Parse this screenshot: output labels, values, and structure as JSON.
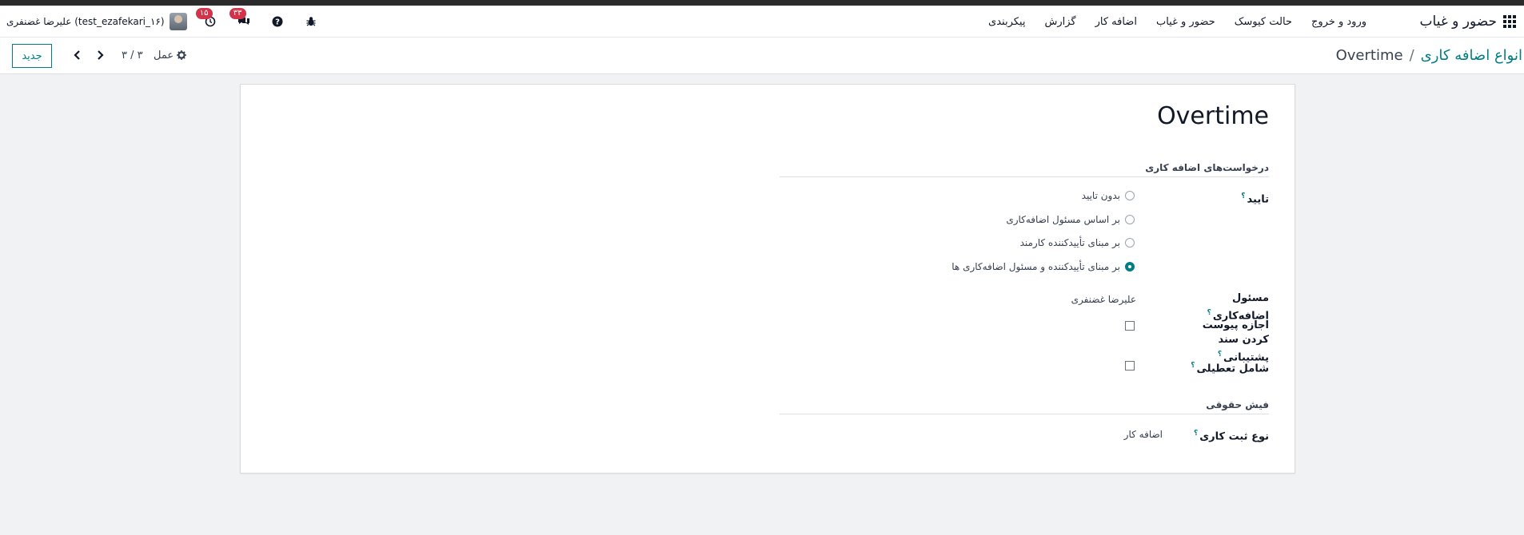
{
  "nav": {
    "brand": "حضور و غیاب",
    "menu": [
      "ورود و خروج",
      "حالت کیوسک",
      "حضور و غیاب",
      "اضافه کار",
      "گزارش",
      "پیکربندی"
    ],
    "user": "علیرضا غضنفری (test_ezafekari_۱۶)",
    "activity_badge": "۱۵",
    "messages_badge": "۳۳"
  },
  "control": {
    "breadcrumb_parent": "انواع اضافه کاری",
    "breadcrumb_sep": "/",
    "breadcrumb_current": "Overtime",
    "new_button": "جدید",
    "pager": "۳ / ۳",
    "action": "عمل"
  },
  "form": {
    "title": "Overtime",
    "section_requests": "درخواست‌های اضافه کاری",
    "approval_label": "تایید",
    "help_mark": "؟",
    "approval_options": [
      {
        "label": "بدون تایید",
        "checked": false
      },
      {
        "label": "بر اساس مسئول اضافه‌کاری",
        "checked": false
      },
      {
        "label": "بر مبنای تأییدکننده کارمند",
        "checked": false
      },
      {
        "label": "بر مبنای تأییدکننده و مسئول اضافه‌کاری ها",
        "checked": true
      }
    ],
    "responsible_label": "مسئول اضافه‌کاری",
    "responsible_value": "علیرضا غضنفری",
    "attachment_label": "اجازه پیوست کردن سند پشتیبانی",
    "holiday_label": "شامل تعطیلی",
    "section_payslip": "فیش حقوقی",
    "entry_type_label": "نوع ثبت کاری",
    "entry_type_value": "اضافه کار"
  }
}
